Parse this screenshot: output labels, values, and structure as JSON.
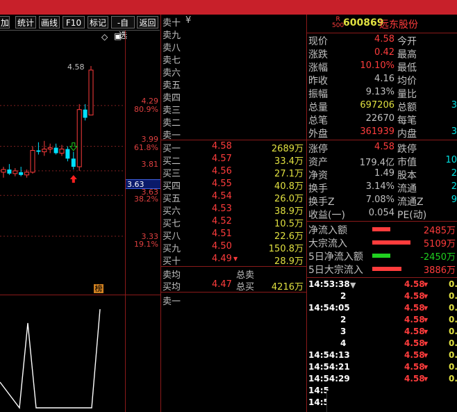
{
  "toolbar": {
    "buttons": [
      "加",
      "统计",
      "画线",
      "F10",
      "标记",
      "-自选",
      "返回"
    ]
  },
  "chart": {
    "high_label": "4.58",
    "price_levels": [
      {
        "price": "4.29",
        "pct": "80.9%"
      },
      {
        "price": "3.99",
        "pct": "61.8%"
      },
      {
        "price": "3.81",
        "pct": ""
      },
      {
        "price": "3.63",
        "pct": "38.2%"
      },
      {
        "price": "3.33",
        "pct": "19.1%"
      }
    ],
    "cursor_value": "3.63",
    "cursor_hidden": "3.63",
    "badge": "榜",
    "up_color": "#ff3c3c",
    "down_color": "#00e0ff",
    "candles": [
      {
        "o": 3.8,
        "h": 3.84,
        "l": 3.76,
        "c": 3.82
      },
      {
        "o": 3.82,
        "h": 3.86,
        "l": 3.78,
        "c": 3.79
      },
      {
        "o": 3.79,
        "h": 3.83,
        "l": 3.77,
        "c": 3.81
      },
      {
        "o": 3.8,
        "h": 3.84,
        "l": 3.77,
        "c": 3.78
      },
      {
        "o": 3.78,
        "h": 3.82,
        "l": 3.76,
        "c": 3.8
      },
      {
        "o": 3.8,
        "h": 3.99,
        "l": 3.79,
        "c": 3.96
      },
      {
        "o": 3.96,
        "h": 4.02,
        "l": 3.93,
        "c": 3.95
      },
      {
        "o": 3.95,
        "h": 4.03,
        "l": 3.92,
        "c": 3.97
      },
      {
        "o": 3.97,
        "h": 4.01,
        "l": 3.94,
        "c": 3.98
      },
      {
        "o": 3.98,
        "h": 4.01,
        "l": 3.93,
        "c": 3.94
      },
      {
        "o": 3.94,
        "h": 4.0,
        "l": 3.92,
        "c": 3.97
      },
      {
        "o": 3.97,
        "h": 3.99,
        "l": 3.88,
        "c": 3.9
      },
      {
        "o": 3.9,
        "h": 3.95,
        "l": 3.82,
        "c": 3.84
      },
      {
        "o": 3.84,
        "h": 4.3,
        "l": 3.81,
        "c": 4.26
      },
      {
        "o": 4.26,
        "h": 4.3,
        "l": 4.18,
        "c": 4.2
      },
      {
        "o": 4.22,
        "h": 4.58,
        "l": 4.22,
        "c": 4.55
      }
    ]
  },
  "stock": {
    "code": "600869",
    "name": "远东股份",
    "badge_top": "R",
    "badge_bottom": "500"
  },
  "orderbook": {
    "sell_header": "卖十",
    "sell_header_symbol": "¥",
    "sells": [
      "卖九",
      "卖八",
      "卖七",
      "卖六",
      "卖五",
      "卖四",
      "卖三",
      "卖二",
      "卖一"
    ],
    "buys": [
      {
        "label": "买一",
        "price": "4.58",
        "vol": "2689万"
      },
      {
        "label": "买二",
        "price": "4.57",
        "vol": "33.4万"
      },
      {
        "label": "买三",
        "price": "4.56",
        "vol": "27.1万"
      },
      {
        "label": "买四",
        "price": "4.55",
        "vol": "40.8万"
      },
      {
        "label": "买五",
        "price": "4.54",
        "vol": "26.0万"
      },
      {
        "label": "买六",
        "price": "4.53",
        "vol": "38.9万"
      },
      {
        "label": "买七",
        "price": "4.52",
        "vol": "10.5万"
      },
      {
        "label": "买八",
        "price": "4.51",
        "vol": "22.6万"
      },
      {
        "label": "买九",
        "price": "4.50",
        "vol": "150.8万"
      },
      {
        "label": "买十",
        "price": "4.49",
        "vol": "28.9万"
      }
    ],
    "sell_avg_label": "卖均",
    "total_sell_label": "总卖",
    "buy_avg_label": "买均",
    "buy_avg": "4.47",
    "total_buy_label": "总买",
    "total_buy": "4216万",
    "bottom_sell": "卖一"
  },
  "quote": {
    "rows": [
      {
        "l1": "现价",
        "v1": "4.58",
        "c1": "r",
        "l2": "今开",
        "v2": ""
      },
      {
        "l1": "涨跌",
        "v1": "0.42",
        "c1": "r",
        "l2": "最高",
        "v2": ""
      },
      {
        "l1": "涨幅",
        "v1": "10.10%",
        "c1": "r",
        "l2": "最低",
        "v2": ""
      },
      {
        "l1": "昨收",
        "v1": "4.16",
        "c1": "gr",
        "l2": "均价",
        "v2": ""
      },
      {
        "l1": "振幅",
        "v1": "9.13%",
        "c1": "gr",
        "l2": "量比",
        "v2": ""
      },
      {
        "l1": "总量",
        "v1": "697206",
        "c1": "y",
        "l2": "总额",
        "v2": "3"
      },
      {
        "l1": "总笔",
        "v1": "22670",
        "c1": "gr",
        "l2": "每笔",
        "v2": ""
      },
      {
        "l1": "外盘",
        "v1": "361939",
        "c1": "r",
        "l2": "内盘",
        "v2": "3"
      }
    ],
    "rows2": [
      {
        "l1": "涨停",
        "v1": "4.58",
        "c1": "r",
        "l2": "跌停",
        "v2": ""
      },
      {
        "l1": "资产",
        "v1": "179.4亿",
        "c1": "gr",
        "l2": "市值",
        "v2": "10"
      },
      {
        "l1": "净资",
        "v1": "1.49",
        "c1": "gr",
        "l2": "股本",
        "v2": "2"
      },
      {
        "l1": "换手",
        "v1": "3.14%",
        "c1": "gr",
        "l2": "流通",
        "v2": "2"
      },
      {
        "l1": "换手Z",
        "v1": "7.08%",
        "c1": "gr",
        "l2": "流通Z",
        "v2": "9"
      },
      {
        "l1": "收益(一)",
        "v1": "0.054",
        "c1": "gr",
        "l2": "PE(动)",
        "v2": ""
      }
    ]
  },
  "flows": [
    {
      "label": "净流入额",
      "value": "2485万",
      "bar": 0.45,
      "color": "#ff3c3c"
    },
    {
      "label": "大宗流入",
      "value": "5109万",
      "bar": 0.95,
      "color": "#ff3c3c"
    },
    {
      "label": "5日净流入额",
      "value": "-2450万",
      "bar": 0.45,
      "color": "#20d020"
    },
    {
      "label": "5日大宗流入",
      "value": "3886万",
      "bar": 0.72,
      "color": "#ff3c3c"
    }
  ],
  "ticks": {
    "filter_symbol": "▼",
    "rows": [
      {
        "time": "14:53:38",
        "price": "4.58",
        "v": "0."
      },
      {
        "time": "2",
        "price": "4.58",
        "v": "0."
      },
      {
        "time": "14:54:05",
        "price": "4.58",
        "v": "0."
      },
      {
        "time": "2",
        "price": "4.58",
        "v": "0."
      },
      {
        "time": "3",
        "price": "4.58",
        "v": "0."
      },
      {
        "time": "4",
        "price": "4.58",
        "v": "0."
      },
      {
        "time": "14:54:13",
        "price": "4.58",
        "v": "0."
      },
      {
        "time": "14:54:21",
        "price": "4.58",
        "v": "0."
      },
      {
        "time": "14:54:29",
        "price": "4.58",
        "v": "0."
      },
      {
        "time": "14:5",
        "price": "",
        "v": ""
      },
      {
        "time": "14:5",
        "price": "",
        "v": ""
      }
    ]
  }
}
